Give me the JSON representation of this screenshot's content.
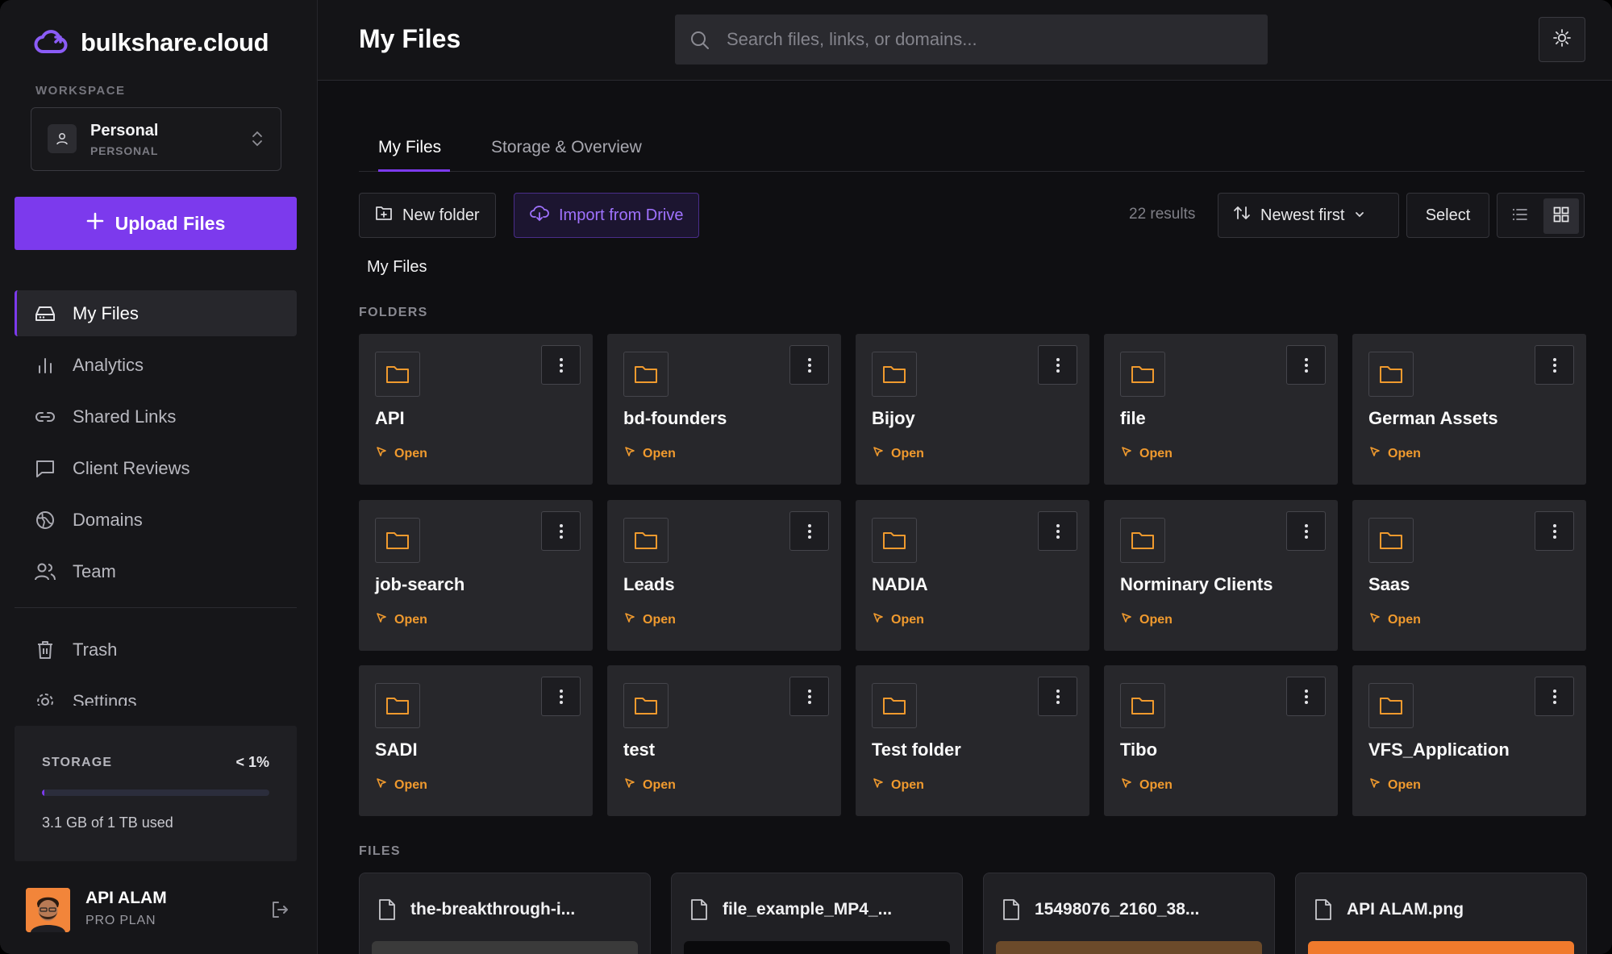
{
  "brand": {
    "name": "bulkshare.cloud",
    "accent": "#7c3aed"
  },
  "workspace": {
    "label": "WORKSPACE",
    "name": "Personal",
    "type": "PERSONAL"
  },
  "upload": {
    "label": "Upload Files"
  },
  "nav": {
    "items": [
      {
        "label": "My Files",
        "icon": "drive-icon",
        "active": true
      },
      {
        "label": "Analytics",
        "icon": "bar-chart-icon"
      },
      {
        "label": "Shared Links",
        "icon": "link-icon"
      },
      {
        "label": "Client Reviews",
        "icon": "message-square-icon"
      },
      {
        "label": "Domains",
        "icon": "globe-icon"
      },
      {
        "label": "Team",
        "icon": "users-icon"
      }
    ],
    "trash": "Trash",
    "settings": "Settings"
  },
  "storage": {
    "label": "STORAGE",
    "percent_text": "< 1%",
    "used_fraction": 0.003,
    "used_text": "3.1 GB of 1 TB used"
  },
  "user": {
    "name": "API ALAM",
    "plan": "PRO PLAN"
  },
  "header": {
    "title": "My Files",
    "search_placeholder": "Search files, links, or domains..."
  },
  "tabs": [
    {
      "label": "My Files",
      "active": true
    },
    {
      "label": "Storage & Overview"
    }
  ],
  "toolbar": {
    "new_folder": "New folder",
    "import": "Import from Drive",
    "results": "22 results",
    "sort": "Newest first",
    "select": "Select",
    "view": "grid"
  },
  "breadcrumb": "My Files",
  "sections": {
    "folders": "FOLDERS",
    "files": "FILES"
  },
  "folder_open_label": "Open",
  "folders": [
    "API",
    "bd-founders",
    "Bijoy",
    "file",
    "German Assets",
    "job-search",
    "Leads",
    "NADIA",
    "Norminary Clients",
    "Saas",
    "SADI",
    "test",
    "Test folder",
    "Tibo",
    "VFS_Application"
  ],
  "files": [
    {
      "name": "the-breakthrough-i...",
      "thumb": "#3a3a3a"
    },
    {
      "name": "file_example_MP4_...",
      "thumb": "#0a0a0c"
    },
    {
      "name": "15498076_2160_38...",
      "thumb": "#6b4a2a"
    },
    {
      "name": "API ALAM.png",
      "thumb": "#f07a2c"
    }
  ],
  "colors": {
    "folder_accent": "#f09a2e",
    "import_text": "#a072ff"
  }
}
